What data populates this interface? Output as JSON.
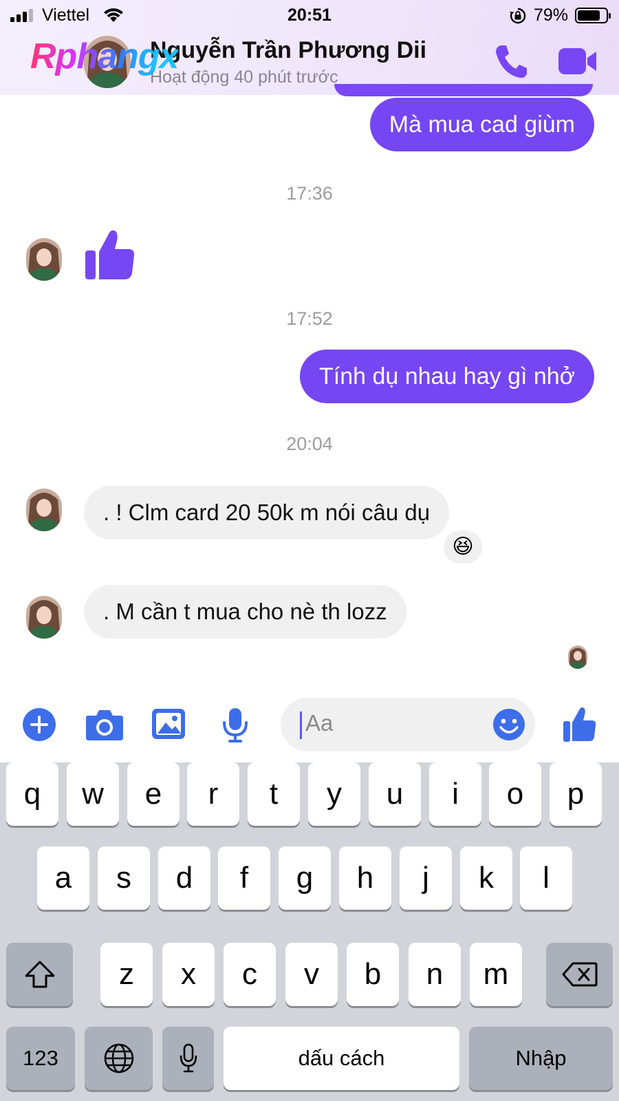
{
  "status_bar": {
    "carrier": "Viettel",
    "time": "20:51",
    "battery_percent": "79%",
    "battery_level": 0.79,
    "signal_bars": 3
  },
  "header": {
    "contact_name": "Nguyễn Trần Phương Dii",
    "presence": "Hoạt động 40 phút trước",
    "watermark": "Rphangx",
    "call_icon": "phone-icon",
    "video_icon": "video-camera-icon"
  },
  "messages": {
    "out_1": "Mà mua cad giùm",
    "time_1": "17:36",
    "like_icon": "thumbs-up-icon",
    "time_2": "17:52",
    "out_2": "Tính dụ nhau hay gì nhở",
    "time_3": "20:04",
    "in_1": ". ! Clm card 20 50k m nói câu dụ",
    "in_1_reaction": "😆",
    "in_2": ". M cần t mua cho nè th lozz"
  },
  "composer": {
    "placeholder": "Aa",
    "icons": [
      "plus-icon",
      "camera-icon",
      "image-icon",
      "microphone-icon",
      "emoji-icon",
      "thumbs-up-icon"
    ]
  },
  "keyboard": {
    "row1": [
      "q",
      "w",
      "e",
      "r",
      "t",
      "y",
      "u",
      "i",
      "o",
      "p"
    ],
    "row2": [
      "a",
      "s",
      "d",
      "f",
      "g",
      "h",
      "j",
      "k",
      "l"
    ],
    "row3": [
      "z",
      "x",
      "c",
      "v",
      "b",
      "n",
      "m"
    ],
    "numbers_label": "123",
    "space_label": "dấu cách",
    "return_label": "Nhập"
  },
  "colors": {
    "accent": "#7646f3",
    "composer_blue": "#3d6de8",
    "incoming_bubble": "#f0f0f0",
    "keyboard_bg": "#d2d4da"
  }
}
